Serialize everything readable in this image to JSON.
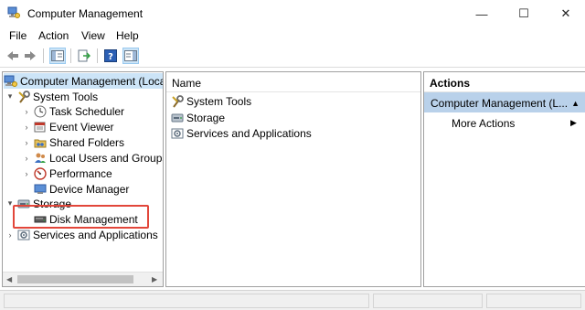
{
  "window": {
    "title": "Computer Management",
    "min_glyph": "—",
    "max_glyph": "☐",
    "close_glyph": "✕"
  },
  "menu": [
    "File",
    "Action",
    "View",
    "Help"
  ],
  "toolbar": {
    "icons": [
      "back-arrow-icon",
      "forward-arrow-icon",
      "console-tree-icon",
      "export-list-icon",
      "help-icon",
      "action-pane-icon"
    ]
  },
  "tree": {
    "root": "Computer Management (Local",
    "items": [
      {
        "label": "System Tools",
        "icon": "tools-icon",
        "expander": "▾"
      },
      {
        "label": "Task Scheduler",
        "icon": "clock-icon",
        "expander": "›"
      },
      {
        "label": "Event Viewer",
        "icon": "event-viewer-icon",
        "expander": "›"
      },
      {
        "label": "Shared Folders",
        "icon": "shared-folders-icon",
        "expander": "›"
      },
      {
        "label": "Local Users and Groups",
        "icon": "users-icon",
        "expander": "›"
      },
      {
        "label": "Performance",
        "icon": "performance-icon",
        "expander": "›"
      },
      {
        "label": "Device Manager",
        "icon": "device-manager-icon",
        "expander": ""
      },
      {
        "label": "Storage",
        "icon": "storage-icon",
        "expander": "▾"
      },
      {
        "label": "Disk Management",
        "icon": "disk-icon",
        "expander": ""
      },
      {
        "label": "Services and Applications",
        "icon": "services-icon",
        "expander": "›"
      }
    ]
  },
  "center": {
    "column_header": "Name",
    "items": [
      {
        "label": "System Tools",
        "icon": "tools-icon"
      },
      {
        "label": "Storage",
        "icon": "storage-icon"
      },
      {
        "label": "Services and Applications",
        "icon": "services-icon"
      }
    ]
  },
  "actions": {
    "header": "Actions",
    "section": "Computer Management (L...",
    "collapse_glyph": "▲",
    "items": [
      {
        "label": "More Actions",
        "arrow": "▶"
      }
    ]
  },
  "scroll": {
    "left_glyph": "◀",
    "right_glyph": "▶"
  },
  "colors": {
    "selection": "#cce4f7",
    "actions_section": "#b9d1ea",
    "highlight_box": "#e2463a"
  }
}
